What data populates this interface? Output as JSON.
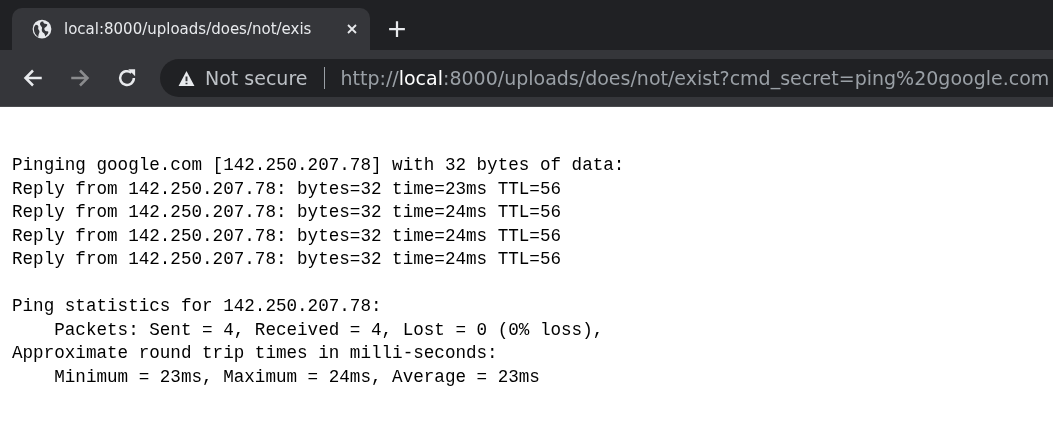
{
  "tab": {
    "title": "local:8000/uploads/does/not/exis",
    "selected": true
  },
  "toolbar": {
    "back": {
      "disabled": false
    },
    "forward": {
      "disabled": true
    }
  },
  "address_bar": {
    "security": "Not secure",
    "url": "http://**local**:8000/uploads/does/not/exist?cmd_secret=ping%20google.com"
  },
  "output_blocks": [
    [
      "Pinging google.com [142.250.207.78] with 32 bytes of data:",
      "Reply from 142.250.207.78: bytes=32 time=23ms TTL=56",
      "Reply from 142.250.207.78: bytes=32 time=24ms TTL=56",
      "Reply from 142.250.207.78: bytes=32 time=24ms TTL=56",
      "Reply from 142.250.207.78: bytes=32 time=24ms TTL=56"
    ],
    [
      "Ping statistics for 142.250.207.78:",
      "    Packets: Sent = 4, Received = 4, Lost = 0 (0% loss),",
      "Approximate round trip times in milli-seconds:",
      "    Minimum = 23ms, Maximum = 24ms, Average = 23ms"
    ]
  ]
}
